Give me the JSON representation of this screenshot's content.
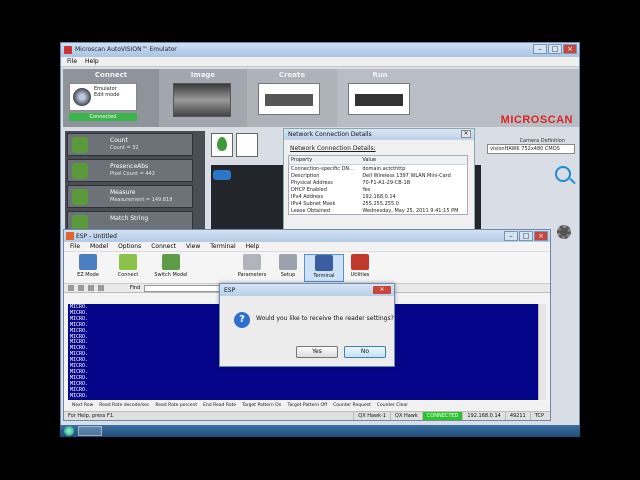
{
  "autovision": {
    "title": "Microscan AutoVISION™ Emulator",
    "menu": [
      "File",
      "Help"
    ],
    "steps": [
      {
        "label": "Connect"
      },
      {
        "label": "Image"
      },
      {
        "label": "Create"
      },
      {
        "label": "Run"
      }
    ],
    "emulator": {
      "title": "Emulator",
      "mode": "Edit mode",
      "status": "Connected"
    },
    "brand": "MICROSCAN",
    "camera_definition_label": "Camera Definition",
    "camera_definition_value": "visionHAWK 752x480 CMOS",
    "left_items": [
      {
        "title": "Count",
        "sub": "Count = 32"
      },
      {
        "title": "PresenceAbs",
        "sub": "Pixel Count = 442"
      },
      {
        "title": "Measure",
        "sub": "Measurement = 149.818"
      },
      {
        "title": "Match String",
        "sub": ""
      }
    ]
  },
  "network_details": {
    "title": "Network Connection Details",
    "subtitle": "Network Connection Details:",
    "columns": [
      "Property",
      "Value"
    ],
    "rows": [
      [
        "Connection-specific DN...",
        "domain.actcthttp"
      ],
      [
        "Description",
        "Dell Wireless 1397 WLAN Mini-Card"
      ],
      [
        "Physical Address",
        "70-F1-A1-29-CB-1B"
      ],
      [
        "DHCP Enabled",
        "Yes"
      ],
      [
        "IPv4 Address",
        "192.168.0.14"
      ],
      [
        "IPv4 Subnet Mask",
        "255.255.255.0"
      ],
      [
        "Lease Obtained",
        "Wednesday, May 25, 2011 9:41:15 PM"
      ]
    ]
  },
  "esp": {
    "title": "ESP - Untitled",
    "menu": [
      "File",
      "Model",
      "Options",
      "Connect",
      "View",
      "Terminal",
      "Help"
    ],
    "toolbar": [
      {
        "label": "EZ Mode",
        "color": "#4a7fc1"
      },
      {
        "label": "Connect",
        "color": "#8ac24a"
      },
      {
        "label": "Switch Model",
        "color": "#5f9c4a"
      },
      {
        "label": "Parameters",
        "color": "#b0b4bb"
      },
      {
        "label": "Setup",
        "color": "#9aa3ad"
      },
      {
        "label": "Terminal",
        "color": "#3a5fa0"
      },
      {
        "label": "Utilities",
        "color": "#c0392b"
      }
    ],
    "find_label": "Find",
    "terminal_lines": [
      "MICRO.",
      "MICRO.",
      "MICRO.",
      "MICRO.",
      "MICRO.",
      "MICRO.",
      "MICRO.",
      "MICRO.",
      "MICRO.",
      "MICRO.",
      "MICRO.",
      "MICRO.",
      "MICRO.",
      "MICRO.",
      "MICRO.",
      "MICRO."
    ],
    "bottom_tabs": [
      "Read Rate decode/sec",
      "Read Rate percent",
      "End Read Rate",
      "Target Pattern On",
      "Target Pattern Off",
      "Counter Request",
      "Counter Clear"
    ],
    "bottom_first": "Next Row",
    "status_help": "For Help, press F1.",
    "status_cells": [
      "QX Hawk-1",
      "QX Hawk",
      "CONNECTED",
      "192.168.0.14",
      "49211",
      "TCP"
    ]
  },
  "confirm": {
    "title": "ESP",
    "question": "Would you like to receive the reader settings?",
    "yes": "Yes",
    "no": "No"
  }
}
